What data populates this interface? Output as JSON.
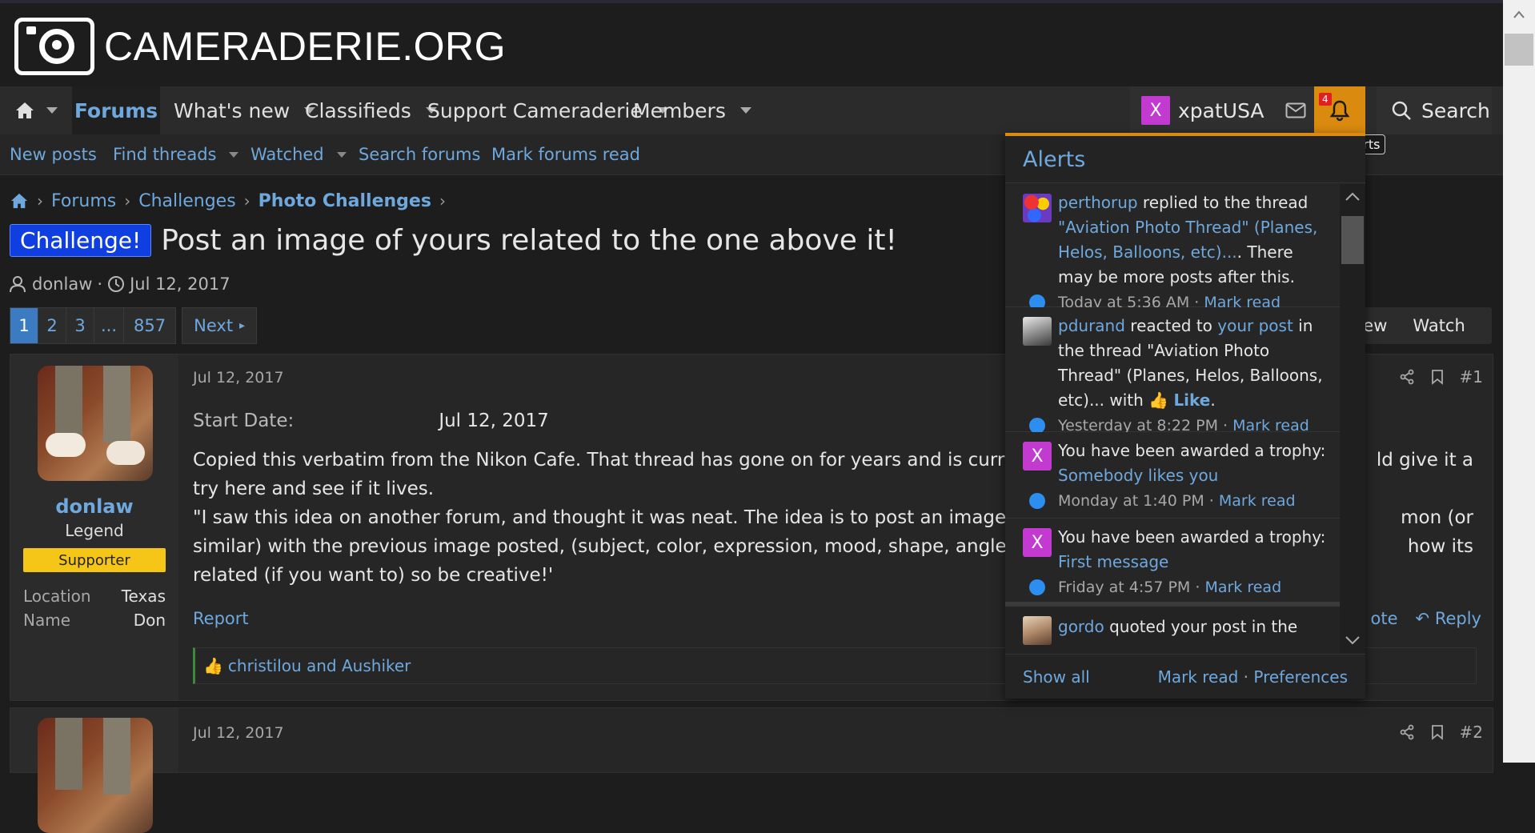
{
  "site": {
    "logo_text": "CAMERADERIE.ORG"
  },
  "nav": {
    "items": [
      {
        "label": "Forums"
      },
      {
        "label": "What's new"
      },
      {
        "label": "Classifieds"
      },
      {
        "label": "Support Cameraderie"
      },
      {
        "label": "Members"
      }
    ],
    "user": {
      "initial": "X",
      "name": "xpatUSA"
    },
    "alerts_badge": "4",
    "search_label": "Search",
    "tooltip": "Alerts"
  },
  "subnav": {
    "items": [
      "New posts",
      "Find threads",
      "Watched",
      "Search forums",
      "Mark forums read"
    ]
  },
  "breadcrumb": [
    "Forums",
    "Challenges",
    "Photo Challenges"
  ],
  "thread": {
    "prefix": "Challenge!",
    "title": "Post an image of yours related to the one above it!",
    "author": "donlaw",
    "date": "Jul 12, 2017",
    "pages": [
      "1",
      "2",
      "3",
      "...",
      "857"
    ],
    "next_label": "Next",
    "right_buttons": [
      "new",
      "Watch"
    ]
  },
  "post1": {
    "date": "Jul 12, 2017",
    "number": "#1",
    "username": "donlaw",
    "user_title": "Legend",
    "banner": "Supporter",
    "info": [
      {
        "key": "Location",
        "value": "Texas"
      },
      {
        "key": "Name",
        "value": "Don"
      }
    ],
    "start_label": "Start Date:",
    "start_value": "Jul 12, 2017",
    "body_line1": "Copied this verbatim from the Nikon Cafe. That thread has gone on for years and is curren",
    "body_line1_end": "ld give it a",
    "body_line2": "try here and see if it lives.",
    "body_line3": "\"I saw this idea on another forum, and thought it was neat. The idea is to post an image of",
    "body_line3_end": "mon (or",
    "body_line4": "similar) with the previous image posted, (subject, color, expression, mood, shape, angle, set",
    "body_line4_end": "how its",
    "body_line5": "related (if you want to) so be creative!'",
    "report": "Report",
    "quote": "ote",
    "reply": "Reply",
    "reactions": "christilou and Aushiker"
  },
  "post2": {
    "date": "Jul 12, 2017",
    "number": "#2"
  },
  "alerts": {
    "title": "Alerts",
    "items": [
      {
        "user": "perthorup",
        "text": " replied to the thread ",
        "link": "\"Aviation Photo Thread\" (Planes, Helos, Balloons, etc)...",
        "tail": ". There may be more posts after this.",
        "time": "Today at 5:36 AM",
        "mark": "Mark read"
      },
      {
        "user": "pdurand",
        "text": " reacted to ",
        "link": "your post",
        "tail": " in the thread \"Aviation Photo Thread\" (Planes, Helos, Balloons, etc)... with ",
        "reaction": "Like",
        "time": "Yesterday at 8:22 PM",
        "mark": "Mark read"
      },
      {
        "initial": "X",
        "text": "You have been awarded a trophy: ",
        "link": "Somebody likes you",
        "time": "Monday at 1:40 PM",
        "mark": "Mark read"
      },
      {
        "initial": "X",
        "text": "You have been awarded a trophy: ",
        "link": "First message",
        "time": "Friday at 4:57 PM",
        "mark": "Mark read"
      },
      {
        "user": "gordo",
        "text": " quoted your post in the"
      }
    ],
    "show_all": "Show all",
    "mark_read": "Mark read",
    "preferences": "Preferences"
  },
  "colors": {
    "accent": "#6fa8dc",
    "alert_bar": "#d98a0f",
    "prefix": "#0f3fe0",
    "supporter": "#f5c518"
  }
}
